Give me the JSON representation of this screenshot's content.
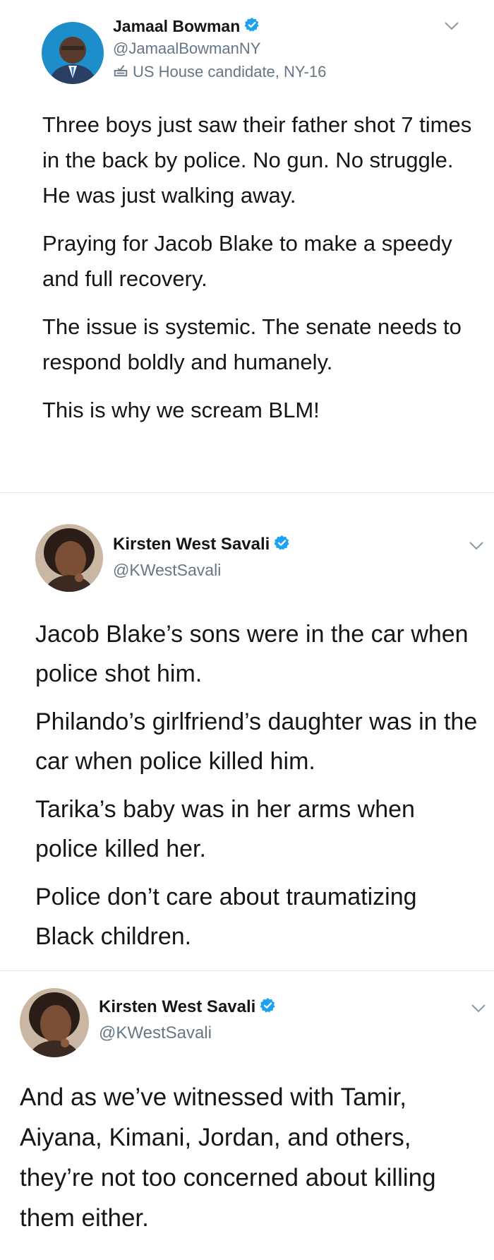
{
  "colors": {
    "verified": "#1da1f2",
    "divider": "#e1e8ed",
    "handle": "#657786",
    "text": "#14171a"
  },
  "tweets": [
    {
      "name": "Jamaal Bowman",
      "handle": "@JamaalBowmanNY",
      "label": "US House candidate, NY-16",
      "paragraphs": [
        "Three boys just saw their father shot 7 times in the back by police. No gun. No struggle. He was just walking away.",
        "Praying for Jacob Blake to make a speedy and full recovery.",
        "The issue is systemic. The senate needs to respond boldly and humanely.",
        "This is why we scream BLM!"
      ]
    },
    {
      "name": "Kirsten West Savali",
      "handle": "@KWestSavali",
      "paragraphs": [
        "Jacob Blake’s sons were in the car when police shot him.",
        "Philando’s girlfriend’s daughter was in the car when police killed him.",
        "Tarika’s baby was in her arms when police killed her.",
        "Police don’t care about traumatizing Black children."
      ]
    },
    {
      "name": "Kirsten West Savali",
      "handle": "@KWestSavali",
      "paragraphs": [
        "And as we’ve witnessed with Tamir, Aiyana, Kimani, Jordan, and others, they’re not too concerned about killing them either."
      ]
    }
  ]
}
